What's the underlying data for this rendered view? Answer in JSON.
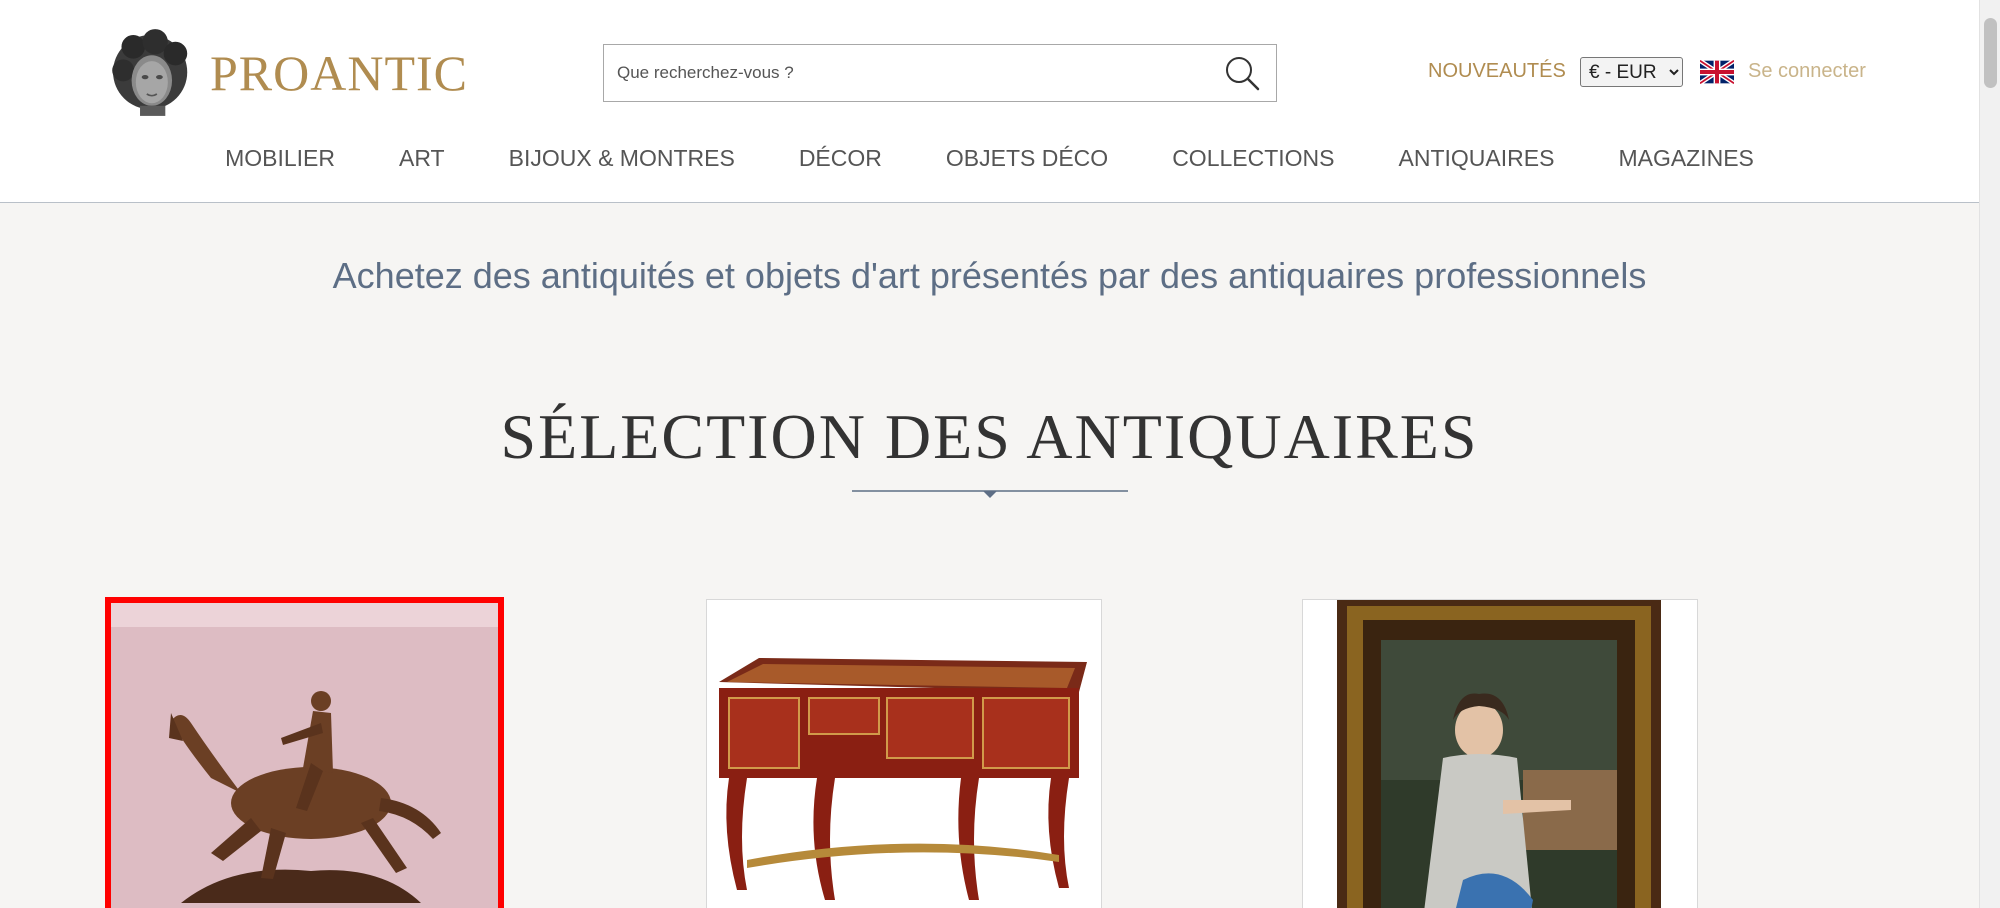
{
  "header": {
    "brand": "PROANTIC",
    "search_placeholder": "Que recherchez-vous ?",
    "nouveautes": "NOUVEAUTÉS",
    "currency": "€ - EUR",
    "login": "Se connecter",
    "language_icon": "uk-flag-icon"
  },
  "nav": {
    "items": [
      {
        "label": "MOBILIER"
      },
      {
        "label": "ART"
      },
      {
        "label": "BIJOUX & MONTRES"
      },
      {
        "label": "DÉCOR"
      },
      {
        "label": "OBJETS DÉCO"
      },
      {
        "label": "COLLECTIONS"
      },
      {
        "label": "ANTIQUAIRES"
      },
      {
        "label": "MAGAZINES"
      }
    ]
  },
  "main": {
    "tagline": "Achetez des antiquités et objets d'art présentés par des antiquaires professionnels",
    "section_title": "SÉLECTION DES ANTIQUAIRES"
  },
  "colors": {
    "brand_gold": "#b08c50",
    "tagline_blue": "#5d6e85",
    "selected_outline": "#ff0000"
  }
}
